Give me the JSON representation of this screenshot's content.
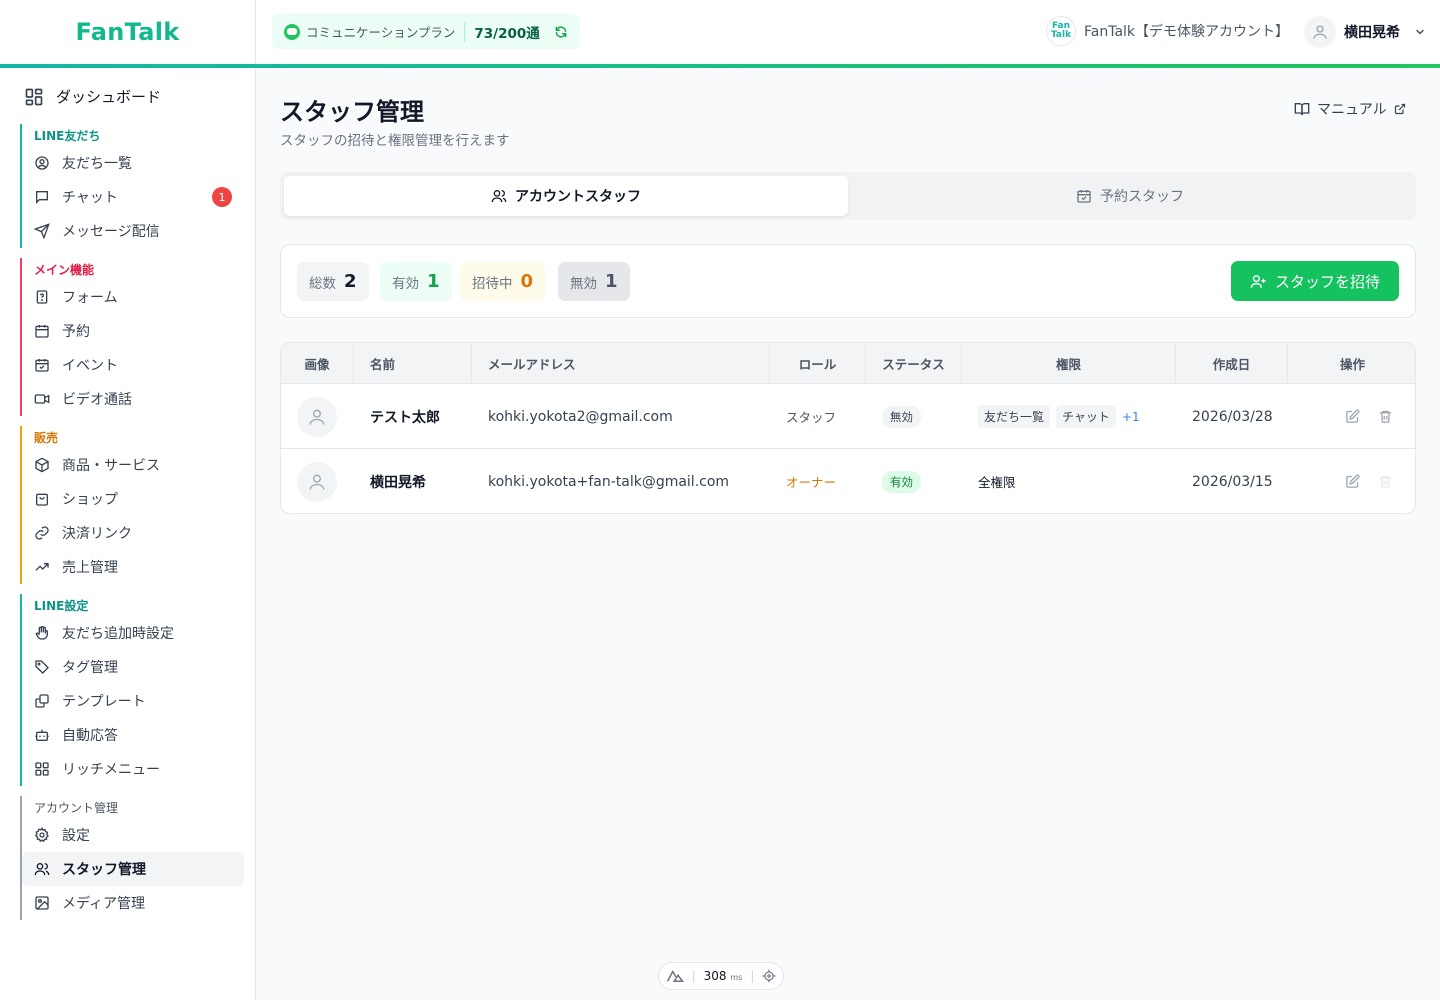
{
  "app": {
    "logo": "FanTalk"
  },
  "header": {
    "plan_label": "コミュニケーションプラン",
    "plan_count": "73/200通",
    "account_logo": "Fan Talk",
    "account_name": "FanTalk【デモ体験アカウント】",
    "user_name": "横田晃希"
  },
  "sidebar": {
    "dashboard": "ダッシュボード",
    "groups": [
      {
        "title": "LINE友だち",
        "color": "#0d9488",
        "items": [
          "友だち一覧",
          "チャット",
          "メッセージ配信"
        ]
      },
      {
        "title": "メイン機能",
        "color": "#e11d48",
        "items": [
          "フォーム",
          "予約",
          "イベント",
          "ビデオ通話"
        ]
      },
      {
        "title": "販売",
        "color": "#d97706",
        "items": [
          "商品・サービス",
          "ショップ",
          "決済リンク",
          "売上管理"
        ]
      },
      {
        "title": "LINE設定",
        "color": "#0d9488",
        "items": [
          "友だち追加時設定",
          "タグ管理",
          "テンプレート",
          "自動応答",
          "リッチメニュー"
        ]
      },
      {
        "title": "アカウント管理",
        "color": "#4b5563",
        "items": [
          "設定",
          "スタッフ管理",
          "メディア管理"
        ]
      }
    ],
    "chat_badge": "1"
  },
  "main": {
    "title": "スタッフ管理",
    "subtitle": "スタッフの招待と権限管理を行えます",
    "manual": "マニュアル",
    "tabs": [
      "アカウントスタッフ",
      "予約スタッフ"
    ],
    "stats": [
      {
        "label": "総数",
        "value": "2",
        "color": "#111827",
        "bg": "#f3f4f6"
      },
      {
        "label": "有効",
        "value": "1",
        "color": "#16a34a",
        "bg": "#ecfdf5"
      },
      {
        "label": "招待中",
        "value": "0",
        "color": "#d97706",
        "bg": "#fffbeb"
      },
      {
        "label": "無効",
        "value": "1",
        "color": "#4b5563",
        "bg": "#e5e7eb"
      }
    ],
    "invite_button": "スタッフを招待",
    "table": {
      "headers": [
        "画像",
        "名前",
        "メールアドレス",
        "ロール",
        "ステータス",
        "権限",
        "作成日",
        "操作"
      ],
      "rows": [
        {
          "name": "テスト太郎",
          "email": "kohki.yokota2@gmail.com",
          "role": "スタッフ",
          "role_color": "#4b5563",
          "status": "無効",
          "status_bg": "#f3f4f6",
          "status_color": "#374151",
          "perms": [
            "友だち一覧",
            "チャット"
          ],
          "perms_more": "+1",
          "created": "2026/03/28"
        },
        {
          "name": "横田晃希",
          "email": "kohki.yokota+fan-talk@gmail.com",
          "role": "オーナー",
          "role_color": "#d97706",
          "status": "有効",
          "status_bg": "#dcfce7",
          "status_color": "#15803d",
          "perms_all": "全権限",
          "created": "2026/03/15"
        }
      ]
    }
  },
  "footer": {
    "ms_value": "308",
    "ms_unit": "ms"
  }
}
